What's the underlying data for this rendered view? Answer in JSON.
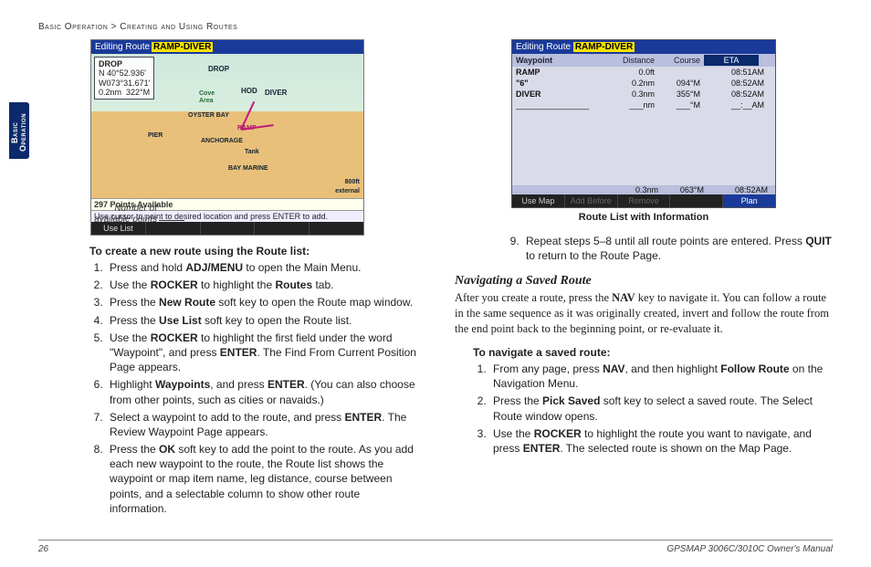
{
  "breadcrumb": {
    "section": "Basic Operation",
    "sep": ">",
    "page": "Creating and Using Routes"
  },
  "sidetab": "Basic Operation",
  "fig_map": {
    "title_prefix": "Editing Route",
    "title_name": "RAMP-DIVER",
    "drop": {
      "name": "DROP",
      "lat": "N  40°52.936'",
      "lon": "W073°31.671'",
      "dist": "0.2nm",
      "brg": "322°M"
    },
    "labels": {
      "drop": "DROP",
      "hod": "HOD",
      "diver": "DIVER",
      "oysterbay": "OYSTER BAY",
      "anchorage": "ANCHORAGE",
      "tank": "Tank",
      "baymarine": "BAY MARINE",
      "ramp": "RAMP",
      "pier": "PIER",
      "cove": "Cove",
      "area": "Area",
      "scale": "800ft",
      "ext": "external"
    },
    "status": "297 Points Available",
    "hint": "Use cursor to point to desired location and press ENTER to add.",
    "softkey": "Use List"
  },
  "callout": "Number of available points",
  "left": {
    "heading": "To create a new route using the Route list:",
    "steps": [
      {
        "pre": "Press and hold ",
        "b1": "ADJ/MENU",
        "post": " to open the Main Menu."
      },
      {
        "pre": "Use the ",
        "b1": "ROCKER",
        "mid": " to highlight the ",
        "b2": "Routes",
        "post": " tab."
      },
      {
        "pre": "Press the ",
        "b1": "New Route",
        "post": " soft key to open the Route map window."
      },
      {
        "pre": "Press the ",
        "b1": "Use List",
        "post": " soft key to open the Route list."
      },
      {
        "pre": "Use the ",
        "b1": "ROCKER",
        "mid": " to highlight the first field under the word \"Waypoint\", and press ",
        "b2": "ENTER",
        "post": ". The Find From Current Position Page appears."
      },
      {
        "pre": "Highlight ",
        "b1": "Waypoints",
        "mid": ", and press ",
        "b2": "ENTER",
        "post": ". (You can also choose from other points, such as cities or navaids.)"
      },
      {
        "pre": "Select a waypoint to add to the route, and press ",
        "b1": "ENTER",
        "post": ". The Review Waypoint Page appears."
      },
      {
        "pre": "Press the ",
        "b1": "OK",
        "post": " soft key to add the point to the route. As you add each new waypoint to the route, the Route list shows the waypoint or map item name, leg distance, course between points, and a selectable column to show other route information."
      }
    ]
  },
  "fig_list": {
    "title_prefix": "Editing Route",
    "title_name": "RAMP-DIVER",
    "headers": {
      "wp": "Waypoint",
      "dist": "Distance",
      "course": "Course",
      "eta": "ETA"
    },
    "rows": [
      {
        "wp": "RAMP",
        "dist": "0.0ft",
        "course": "",
        "eta": "08:51AM"
      },
      {
        "wp": "\"6\"",
        "dist": "0.2nm",
        "course": "094°M",
        "eta": "08:52AM"
      },
      {
        "wp": "DIVER",
        "dist": "0.3nm",
        "course": "355°M",
        "eta": "08:52AM"
      },
      {
        "wp": "________________",
        "dist": "___nm",
        "course": "___°M",
        "eta": "__:__AM"
      }
    ],
    "totals": {
      "dist": "0.3nm",
      "course": "063°M",
      "eta": "08:52AM"
    },
    "softkeys": {
      "usemap": "Use Map",
      "addbefore": "Add Before",
      "remove": "Remove",
      "plan": "Plan"
    },
    "caption": "Route List with Information"
  },
  "right": {
    "step9": {
      "pre": "Repeat steps 5–8 until all route points are entered. Press ",
      "b1": "QUIT",
      "post": " to return to the Route Page."
    },
    "nav_heading": "Navigating a Saved Route",
    "nav_body": {
      "p1": "After you create a route, press the ",
      "b1": "NAV",
      "p2": " key to navigate it. You can follow a route in the same sequence as it was originally created, invert and follow the route from the end point back to the beginning point, or re-evaluate it."
    },
    "sub_heading": "To navigate a saved route:",
    "steps": [
      {
        "pre": "From any page, press ",
        "b1": "NAV",
        "mid": ", and then highlight ",
        "b2": "Follow Route",
        "post": " on the Navigation Menu."
      },
      {
        "pre": "Press the ",
        "b1": "Pick Saved",
        "post": " soft key to select a saved route. The Select Route window opens."
      },
      {
        "pre": "Use the ",
        "b1": "ROCKER",
        "mid": " to highlight the route you want to navigate, and press ",
        "b2": "ENTER",
        "post": ". The selected route is shown on the Map Page."
      }
    ]
  },
  "footer": {
    "page": "26",
    "manual": "GPSMAP 3006C/3010C Owner's Manual"
  }
}
